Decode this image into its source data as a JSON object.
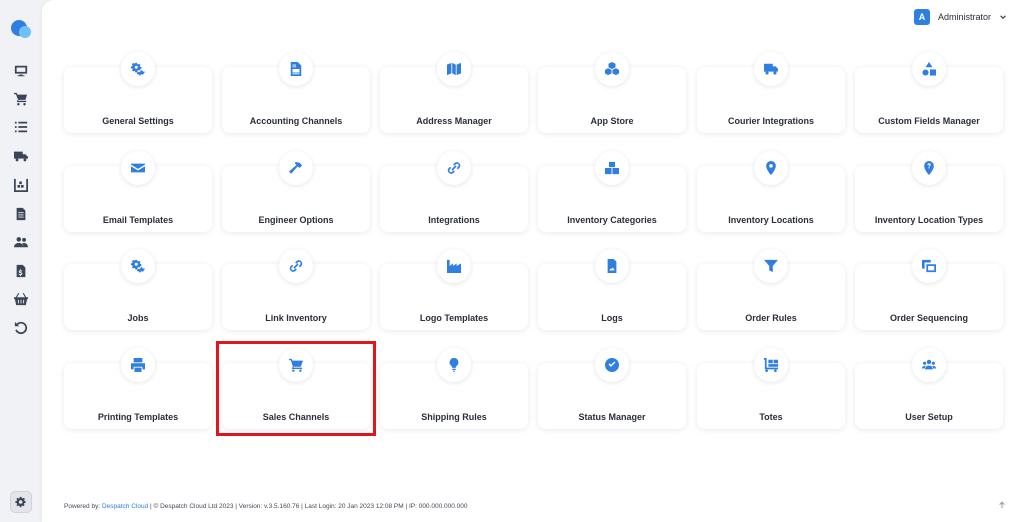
{
  "header": {
    "avatar_letter": "A",
    "user_name": "Administrator"
  },
  "sidebar": {
    "items": [
      {
        "icon": "monitor-icon"
      },
      {
        "icon": "cart-icon"
      },
      {
        "icon": "list-icon"
      },
      {
        "icon": "truck-icon"
      },
      {
        "icon": "warehouse-icon"
      },
      {
        "icon": "document-icon"
      },
      {
        "icon": "users-icon"
      },
      {
        "icon": "invoice-icon"
      },
      {
        "icon": "basket-icon"
      },
      {
        "icon": "history-icon"
      }
    ],
    "bottom_icon": "cogs-icon"
  },
  "tiles": [
    {
      "label": "General Settings",
      "icon": "cogs-icon"
    },
    {
      "label": "Accounting Channels",
      "icon": "file-invoice-icon"
    },
    {
      "label": "Address Manager",
      "icon": "map-icon"
    },
    {
      "label": "App Store",
      "icon": "cubes-icon"
    },
    {
      "label": "Courier Integrations",
      "icon": "truck-icon"
    },
    {
      "label": "Custom Fields Manager",
      "icon": "shapes-icon"
    },
    {
      "label": "Email Templates",
      "icon": "envelope-icon"
    },
    {
      "label": "Engineer Options",
      "icon": "hammer-icon"
    },
    {
      "label": "Integrations",
      "icon": "link-icon"
    },
    {
      "label": "Inventory Categories",
      "icon": "boxes-icon"
    },
    {
      "label": "Inventory Locations",
      "icon": "map-marker-icon"
    },
    {
      "label": "Inventory Location Types",
      "icon": "map-marker-question-icon"
    },
    {
      "label": "Jobs",
      "icon": "cogs-icon"
    },
    {
      "label": "Link Inventory",
      "icon": "link-icon"
    },
    {
      "label": "Logo Templates",
      "icon": "industry-icon"
    },
    {
      "label": "Logs",
      "icon": "file-image-icon"
    },
    {
      "label": "Order Rules",
      "icon": "filter-icon"
    },
    {
      "label": "Order Sequencing",
      "icon": "clone-icon"
    },
    {
      "label": "Printing Templates",
      "icon": "print-icon"
    },
    {
      "label": "Sales Channels",
      "icon": "shopping-cart-icon"
    },
    {
      "label": "Shipping Rules",
      "icon": "lightbulb-icon"
    },
    {
      "label": "Status Manager",
      "icon": "check-circle-icon"
    },
    {
      "label": "Totes",
      "icon": "dolly-icon"
    },
    {
      "label": "User Setup",
      "icon": "users-icon"
    }
  ],
  "footer": {
    "prefix": "Powered by: ",
    "link": "Despatch Cloud",
    "rest": " | © Despatch Cloud Ltd 2023 | Version: v.3.5.160.76 | Last Login: 20 Jan 2023 12:08 PM | IP: 000.000.000.000"
  },
  "colors": {
    "accent": "#2f7fe0",
    "highlight": "#e0161c",
    "background": "#f1f2f6"
  }
}
